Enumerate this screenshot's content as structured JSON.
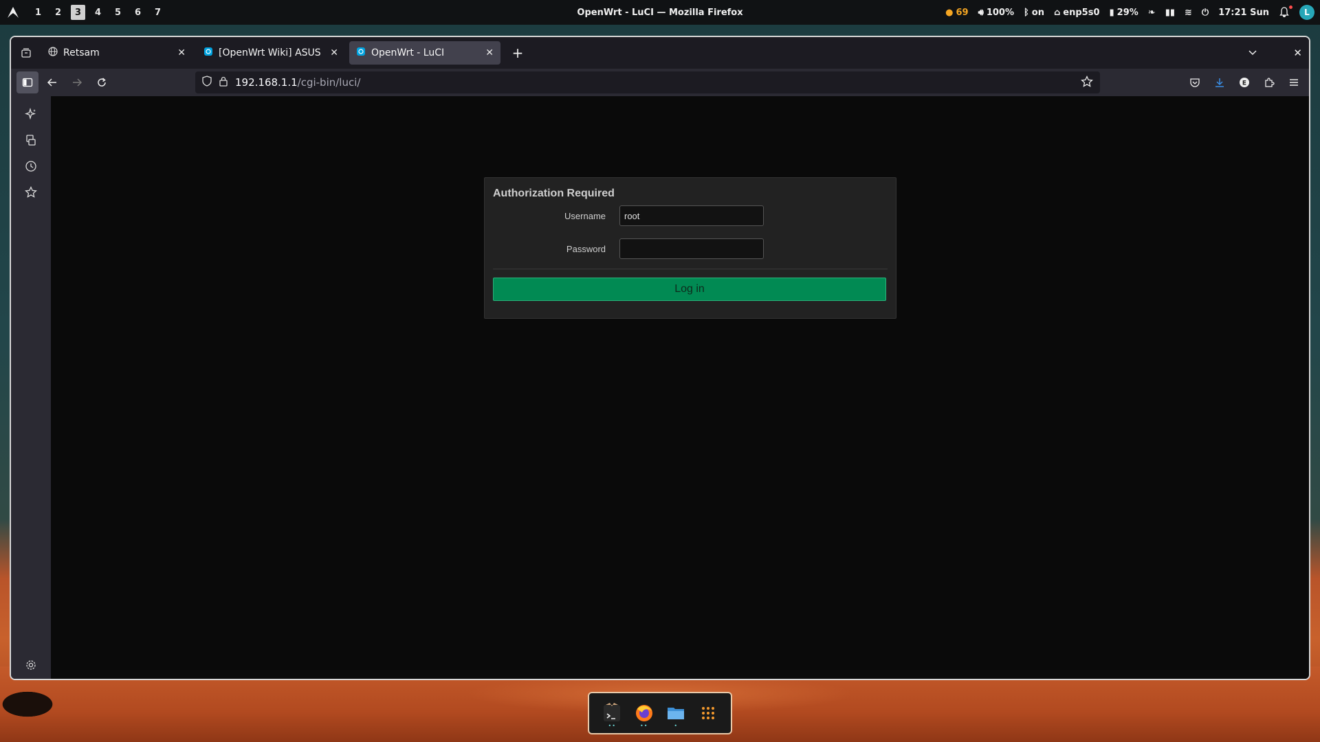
{
  "top_panel": {
    "workspaces": [
      "1",
      "2",
      "3",
      "4",
      "5",
      "6",
      "7"
    ],
    "active_workspace": "3",
    "window_title": "OpenWrt - LuCI — Mozilla Firefox",
    "tray": {
      "updates": "69",
      "volume": "100%",
      "bluetooth": "on",
      "network": "enp5s0",
      "battery": "29%",
      "clock": "17:21 Sun",
      "avatar_letter": "L"
    }
  },
  "browser": {
    "tabs": [
      {
        "title": "Retsam",
        "icon": "globe-icon",
        "active": false
      },
      {
        "title": "[OpenWrt Wiki] ASUS RT",
        "icon": "openwrt-icon",
        "active": false
      },
      {
        "title": "OpenWrt - LuCI",
        "icon": "openwrt-icon",
        "active": true
      }
    ],
    "url_host": "192.168.1.1",
    "url_path": "/cgi-bin/luci/",
    "colors": {
      "accent": "#42414d",
      "toolbar": "#2b2a33"
    }
  },
  "login": {
    "title": "Authorization Required",
    "username_label": "Username",
    "username_value": "root",
    "password_label": "Password",
    "password_value": "",
    "button_label": "Log in",
    "button_color": "#018a53"
  },
  "dock": {
    "items": [
      "terminal-icon",
      "firefox-icon",
      "files-icon",
      "app-grid-icon"
    ]
  }
}
